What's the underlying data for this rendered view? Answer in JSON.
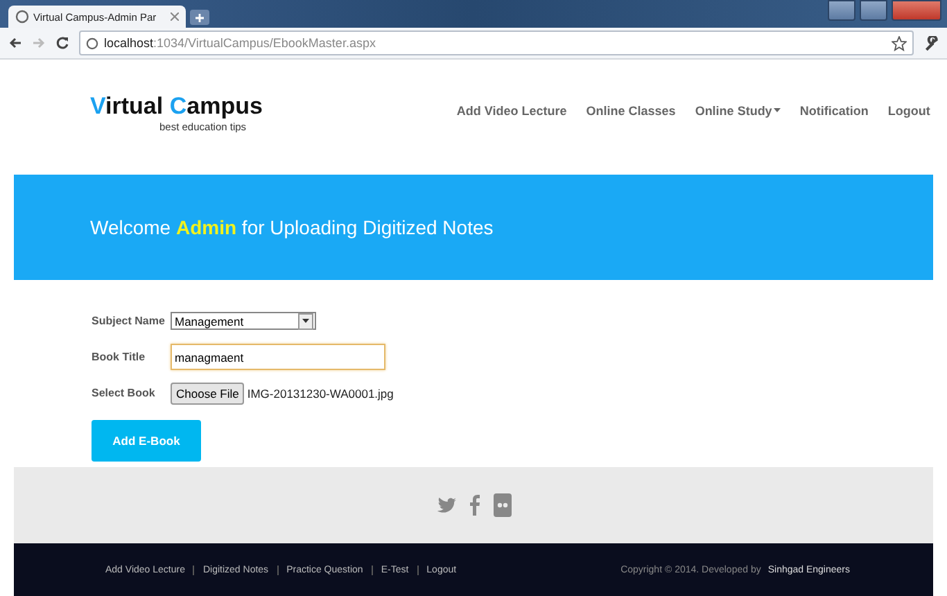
{
  "browser": {
    "tab_title": "Virtual Campus-Admin Par",
    "url_host": "localhost",
    "url_rest": ":1034/VirtualCampus/EbookMaster.aspx"
  },
  "logo": {
    "words": [
      {
        "initial": "V",
        "rest": "irtual"
      },
      {
        "initial": "C",
        "rest": "ampus"
      }
    ],
    "tagline": "best education tips"
  },
  "nav": [
    {
      "label": "Add Video Lecture",
      "kind": "link"
    },
    {
      "label": "Online Classes",
      "kind": "link"
    },
    {
      "label": "Online Study",
      "kind": "dropdown"
    },
    {
      "label": "Notification",
      "kind": "link"
    },
    {
      "label": "Logout",
      "kind": "link"
    }
  ],
  "banner": {
    "text": "Welcome **Admin** for Uploading Digitized Notes"
  },
  "form": {
    "fields": [
      {
        "label": "Subject Name",
        "kind": "select",
        "value": "Management"
      },
      {
        "label": "Book Title",
        "kind": "text",
        "value": "managmaent",
        "focused": true
      },
      {
        "label": "Select Book",
        "kind": "file",
        "button": "Choose File",
        "value": "IMG-20131230-WA0001.jpg"
      }
    ],
    "submit": "Add E-Book"
  },
  "footer": {
    "links": [
      "Add Video Lecture",
      "Digitized Notes",
      "Practice Question",
      "E-Test",
      "Logout"
    ],
    "copyright": "Copyright © 2014. Developed by",
    "developer": "Sinhgad Engineers"
  }
}
